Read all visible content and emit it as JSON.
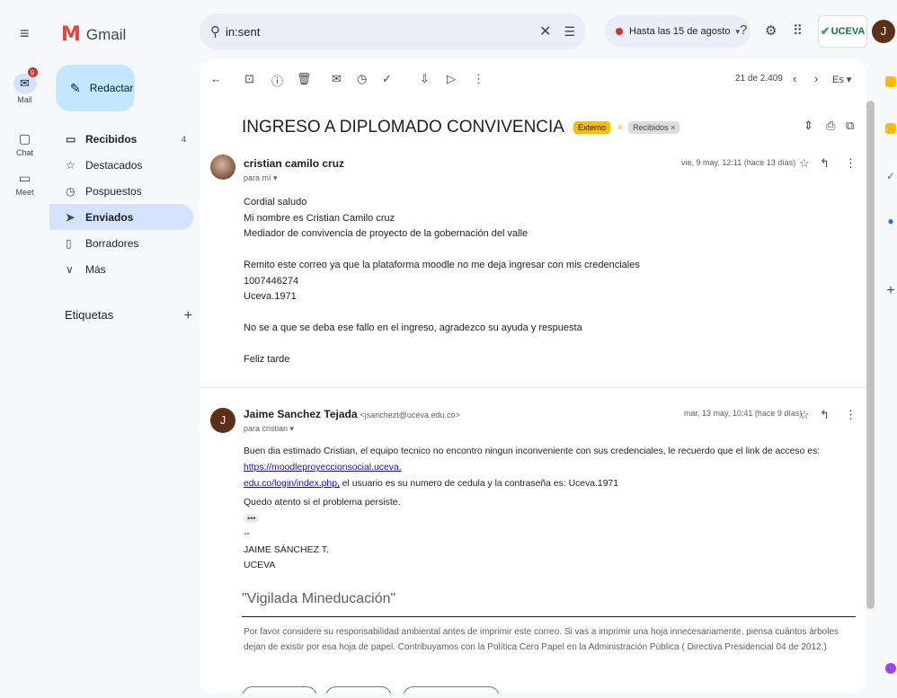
{
  "rail": {
    "mail_label": "Mail",
    "mail_badge": "9",
    "chat_label": "Chat",
    "meet_label": "Meet"
  },
  "header": {
    "app_name": "Gmail",
    "search_query": "in:sent",
    "status_label": "Hasta las 15 de agosto",
    "org_logo_text": "UCEVA",
    "account_initial": "J"
  },
  "sidebar": {
    "compose_label": "Redactar",
    "items": [
      {
        "label": "Recibidos",
        "count": "4"
      },
      {
        "label": "Destacados"
      },
      {
        "label": "Pospuestos"
      },
      {
        "label": "Enviados"
      },
      {
        "label": "Borradores"
      },
      {
        "label": "Más"
      }
    ],
    "labels_title": "Etiquetas"
  },
  "toolbar": {
    "pager": "21 de 2.409",
    "lang": "Es"
  },
  "thread": {
    "subject": "INGRESO A DIPLOMADO CONVIVENCIA",
    "chip_external": "Externo",
    "chip_inbox": "Recibidos ×"
  },
  "messages": [
    {
      "sender": "cristian camilo cruz",
      "to": "para mí ▾",
      "date": "vie, 9 may, 12:11 (hace 13 días)",
      "lines": [
        "Cordial saludo",
        "Mi nombre es Cristian Camilo cruz",
        "Mediador de convivencia de proyecto de la gobernación del valle",
        "",
        "Remito este correo ya que la plataforma moodle no me deja ingresar con mis credenciales",
        "1007446274",
        "Uceva.1971",
        "",
        "No se a que se deba ese fallo en el ingreso, agradezco su ayuda y respuesta",
        "",
        "Feliz tarde"
      ]
    },
    {
      "sender": "Jaime Sanchez Tejada",
      "sender_email": "<jsanchezt@uceva.edu.co>",
      "avatar_initial": "J",
      "to": "para cristian ▾",
      "date": "mar, 13 may, 10:41 (hace 9 días)",
      "body_pre": "Buen dia estimado Cristian, el equipo tecnico no encontro ningun inconveniente con sus credenciales, le recuerdo que el link de acceso es: ",
      "link_line1": "https://moodleproyeccionsocial.uceva.",
      "link_line2": "edu.co/login/index.php,",
      "body_post": " el usuario es su numero de cedula y la contraseña es: Uceva.1971",
      "closing": "Quedo atento si el problema persiste.",
      "dots": "•••",
      "sig_dash": "--",
      "sig_name": "JAIME SÁNCHEZ T.",
      "sig_org": "UCEVA",
      "vigilada": "\"Vigilada Mineducación\"",
      "disclaimer": "Por favor considere su responsabilidad ambiental antes de imprimir este correo.  Si vas a imprimir una hoja innecesariamente, piensa cuántos árboles dejan de existir por esa hoja de papel.  Contribuyamos con la Política Cero Papel en la Administración Pública ( Directiva Presidencial 04 de 2012.)"
    }
  ],
  "colors": {
    "compose_bg": "#c2e7ff",
    "active_nav": "#d3e3fd",
    "chip_external": "#fbbc04",
    "badge": "#d93025"
  }
}
